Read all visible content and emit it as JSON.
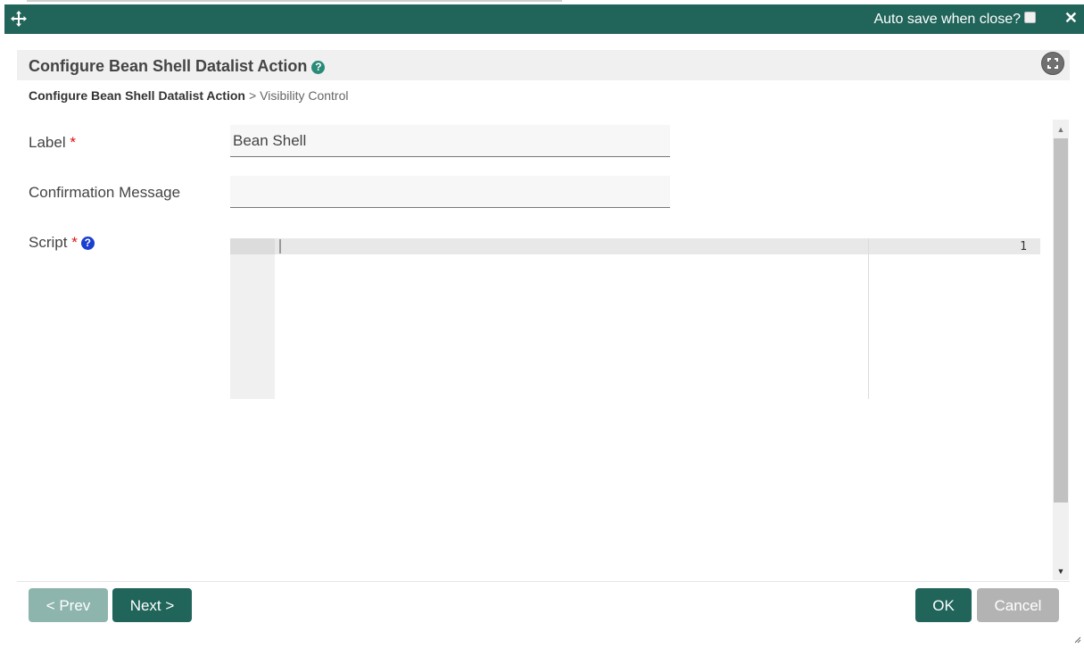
{
  "titlebar": {
    "autosave_label": "Auto save when close?",
    "autosave_checked": false,
    "close_glyph": "✕"
  },
  "header": {
    "title": "Configure Bean Shell Datalist Action",
    "help_glyph": "?"
  },
  "breadcrumb": {
    "current": "Configure Bean Shell Datalist Action",
    "separator": ">",
    "next": "Visibility Control"
  },
  "form": {
    "label": {
      "label": "Label",
      "required_mark": "*",
      "value": "Bean Shell"
    },
    "confirmation": {
      "label": "Confirmation Message",
      "value": ""
    },
    "script": {
      "label": "Script",
      "required_mark": "*",
      "help_glyph": "?",
      "line_number": "1"
    }
  },
  "footer": {
    "prev_label": "< Prev",
    "next_label": "Next >",
    "ok_label": "OK",
    "cancel_label": "Cancel"
  },
  "colors": {
    "primary": "#20645a",
    "primary_disabled": "#8db5ad",
    "cancel": "#b3b3b3",
    "required": "#dd1111",
    "help_blue": "#1a3fd1"
  },
  "icons": {
    "move": "move-icon",
    "close": "close-icon",
    "help": "help-icon",
    "fullscreen": "fullscreen-icon",
    "resize": "resize-grip-icon"
  }
}
